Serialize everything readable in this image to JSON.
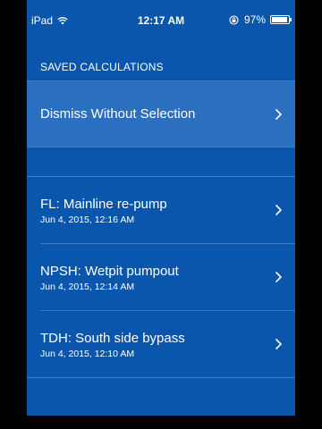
{
  "status_bar": {
    "carrier": "iPad",
    "time": "12:17 AM",
    "battery_percent": "97%",
    "battery_level": 0.97
  },
  "section": {
    "header": "SAVED CALCULATIONS"
  },
  "dismiss": {
    "label": "Dismiss Without Selection"
  },
  "calculations": [
    {
      "title": "FL: Mainline re-pump",
      "date": "Jun 4, 2015, 12:16 AM"
    },
    {
      "title": "NPSH: Wetpit pumpout",
      "date": "Jun 4, 2015, 12:14 AM"
    },
    {
      "title": "TDH: South side bypass",
      "date": "Jun 4, 2015, 12:10 AM"
    }
  ],
  "colors": {
    "background": "#0a56ad",
    "highlight_row": "#2b6fc1",
    "divider": "#3f7cc4",
    "text": "#ffffff"
  },
  "icons": {
    "wifi": "wifi-icon",
    "orientation_lock": "orientation-lock-icon",
    "battery": "battery-icon",
    "chevron": "chevron-right-icon"
  }
}
